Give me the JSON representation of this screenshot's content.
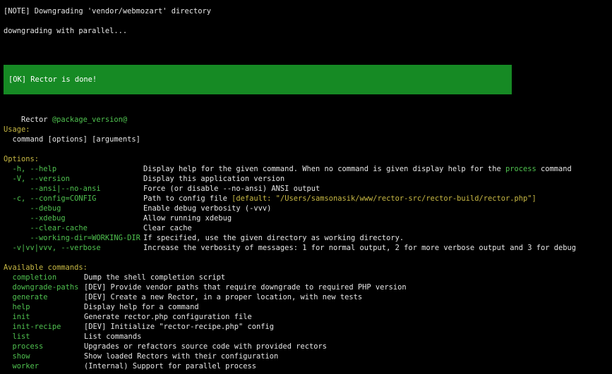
{
  "terminal": {
    "note_line": "[NOTE] Downgrading 'vendor/webmozart' directory",
    "progress_line": "downgrading with parallel...",
    "ok_message": "[OK] Rector is done!",
    "app_name": "Rector",
    "app_version": "@package_version@",
    "usage_heading": "Usage:",
    "usage_line": "  command [options] [arguments]",
    "options_heading": "Options:",
    "options": [
      {
        "name": "  -h, --help",
        "desc": "Display help for the given command. When no command is given display help for the ",
        "desc_highlight": "process",
        "desc_tail": " command"
      },
      {
        "name": "  -V, --version",
        "desc": "Display this application version"
      },
      {
        "name": "      --ansi|--no-ansi",
        "desc": "Force (or disable --no-ansi) ANSI output"
      },
      {
        "name": "  -c, --config=CONFIG",
        "desc": "Path to config file ",
        "desc_default": "[default: \"/Users/samsonasik/www/rector-src/rector-build/rector.php\"]"
      },
      {
        "name": "      --debug",
        "desc": "Enable debug verbosity (-vvv)"
      },
      {
        "name": "      --xdebug",
        "desc": "Allow running xdebug"
      },
      {
        "name": "      --clear-cache",
        "desc": "Clear cache"
      },
      {
        "name": "      --working-dir=WORKING-DIR",
        "desc": "If specified, use the given directory as working directory."
      },
      {
        "name": "  -v|vv|vvv, --verbose",
        "desc": "Increase the verbosity of messages: 1 for normal output, 2 for more verbose output and 3 for debug"
      }
    ],
    "commands_heading": "Available commands:",
    "commands": [
      {
        "name": "  completion",
        "desc": "Dump the shell completion script"
      },
      {
        "name": "  downgrade-paths",
        "desc": "[DEV] Provide vendor paths that require downgrade to required PHP version"
      },
      {
        "name": "  generate",
        "desc": "[DEV] Create a new Rector, in a proper location, with new tests"
      },
      {
        "name": "  help",
        "desc": "Display help for a command"
      },
      {
        "name": "  init",
        "desc": "Generate rector.php configuration file"
      },
      {
        "name": "  init-recipe",
        "desc": "[DEV] Initialize \"rector-recipe.php\" config"
      },
      {
        "name": "  list",
        "desc": "List commands"
      },
      {
        "name": "  process",
        "desc": "Upgrades or refactors source code with provided rectors"
      },
      {
        "name": "  show",
        "desc": "Show loaded Rectors with their configuration"
      },
      {
        "name": "  worker",
        "desc": "(Internal) Support for parallel process"
      }
    ]
  },
  "colors": {
    "background": "#000000",
    "text": "#e6e6e6",
    "heading_yellow": "#c8b944",
    "option_green": "#4fc14f",
    "ok_block_green": "#168a24"
  }
}
